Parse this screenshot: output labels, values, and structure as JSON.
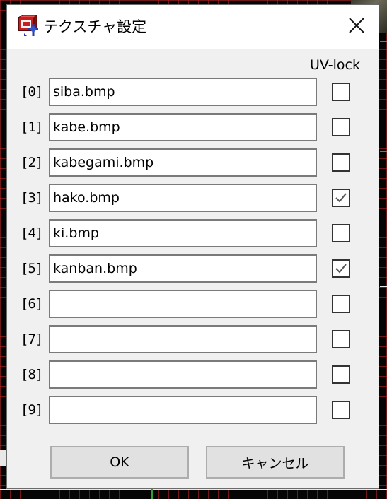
{
  "window": {
    "title": "テクスチャ設定",
    "icon": "app-cube-icon",
    "close_icon": "close-icon"
  },
  "uvlock_header": "UV-lock",
  "rows": [
    {
      "label": "[0]",
      "value": "siba.bmp",
      "uvlock": false
    },
    {
      "label": "[1]",
      "value": "kabe.bmp",
      "uvlock": false
    },
    {
      "label": "[2]",
      "value": "kabegami.bmp",
      "uvlock": false
    },
    {
      "label": "[3]",
      "value": "hako.bmp",
      "uvlock": true
    },
    {
      "label": "[4]",
      "value": "ki.bmp",
      "uvlock": false
    },
    {
      "label": "[5]",
      "value": "kanban.bmp",
      "uvlock": true
    },
    {
      "label": "[6]",
      "value": "",
      "uvlock": false
    },
    {
      "label": "[7]",
      "value": "",
      "uvlock": false
    },
    {
      "label": "[8]",
      "value": "",
      "uvlock": false
    },
    {
      "label": "[9]",
      "value": "",
      "uvlock": false
    }
  ],
  "buttons": {
    "ok": "OK",
    "cancel": "キャンセル"
  }
}
